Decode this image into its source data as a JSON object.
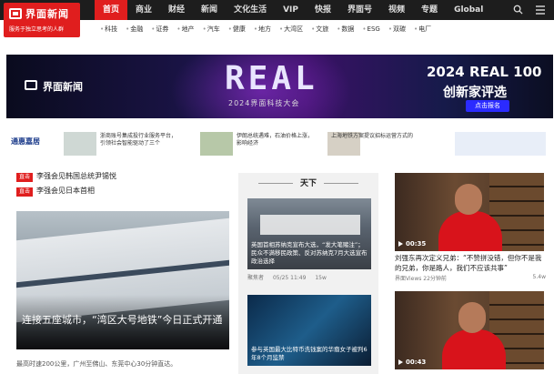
{
  "logo": {
    "name": "界面新闻",
    "slogan": "服务于独立思考的人群"
  },
  "nav": {
    "items": [
      "首页",
      "商业",
      "财经",
      "新闻",
      "文化生活",
      "VIP",
      "快报",
      "界面号",
      "视频",
      "专题",
      "Global"
    ]
  },
  "subnav": {
    "items": [
      "科技",
      "金融",
      "证券",
      "地产",
      "汽车",
      "健康",
      "地方",
      "大湾区",
      "文旅",
      "数据",
      "ESG",
      "双碳",
      "电厂"
    ]
  },
  "banner": {
    "brand": "界面新闻",
    "headline": "REAL",
    "subtitle": "2024界面科技大会",
    "award_line1": "2024 REAL 100",
    "award_line2": "创新家评选",
    "cta": "点击报名"
  },
  "ads": {
    "logo": "通惠嘉居",
    "items": [
      {
        "text": "浙商账号集成投行业服务平台，引领社会智能驱动了三个"
      },
      {
        "text": "伊朗总统遇难，石油价格上涨，影响经济"
      },
      {
        "text": "上海地铁方案提议招标运营方式的"
      },
      {
        "text": ""
      }
    ]
  },
  "flash": [
    {
      "tag": "直击",
      "text": "李强会见韩国总统尹锡悦"
    },
    {
      "tag": "直击",
      "text": "李强会见日本首相"
    }
  ],
  "lead": {
    "caption": "连接五座城市，“湾区大号地铁”今日正式开通",
    "sub": "最高时速200公里，广州至佛山、东莞中心30分钟直达。"
  },
  "tianxia": {
    "heading": "天下",
    "cards": [
      {
        "caption": "英国首相苏纳克宣布大选，“发大笔赌注”；民众不满移民政策、反对苏纳克7月大选宣布政治选择",
        "source": "聚焦者",
        "time": "05/25 11:49",
        "views": "15w"
      },
      {
        "caption": "参与英国最大比特币洗钱案的华裔女子被判6年8个月监禁",
        "source": "",
        "time": "",
        "views": ""
      }
    ]
  },
  "videos": [
    {
      "duration": "00:35",
      "title": "刘强东再次定义兄弟：“不赞拼没错，但你不是我的兄弟，你是路人，我们不应该共事”",
      "source": "界面Views",
      "time": "22分钟前",
      "views": "5.4w"
    },
    {
      "duration": "00:43",
      "title": "",
      "source": "",
      "time": "",
      "views": ""
    }
  ],
  "colors": {
    "brand_red": "#e01e1e",
    "nav_bg": "#1d1d1d"
  }
}
